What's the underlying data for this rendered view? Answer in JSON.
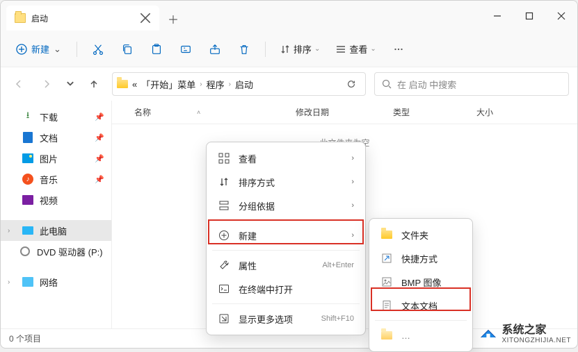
{
  "titlebar": {
    "tab_title": "启动"
  },
  "toolbar": {
    "new_label": "新建",
    "sort_label": "排序",
    "view_label": "查看"
  },
  "breadcrumb": {
    "prefix": "«",
    "seg1": "「开始」菜单",
    "seg2": "程序",
    "seg3": "启动"
  },
  "search": {
    "placeholder": "在 启动 中搜索"
  },
  "columns": {
    "name": "名称",
    "modified": "修改日期",
    "type": "类型",
    "size": "大小"
  },
  "sidebar": {
    "downloads": "下载",
    "documents": "文档",
    "pictures": "图片",
    "music": "音乐",
    "videos": "视频",
    "thispc": "此电脑",
    "dvd": "DVD 驱动器 (P:)",
    "network": "网络"
  },
  "empty_text": "此文件夹为空",
  "context_menu": {
    "view": "查看",
    "sort": "排序方式",
    "group": "分组依据",
    "new": "新建",
    "properties": "属性",
    "properties_shortcut": "Alt+Enter",
    "terminal": "在终端中打开",
    "more": "显示更多选项",
    "more_shortcut": "Shift+F10"
  },
  "submenu": {
    "folder": "文件夹",
    "shortcut": "快捷方式",
    "bmp": "BMP 图像",
    "txt": "文本文档"
  },
  "statusbar": {
    "count": "0 个项目"
  },
  "watermark": {
    "title": "系统之家",
    "url": "XITONGZHIJIA.NET"
  }
}
